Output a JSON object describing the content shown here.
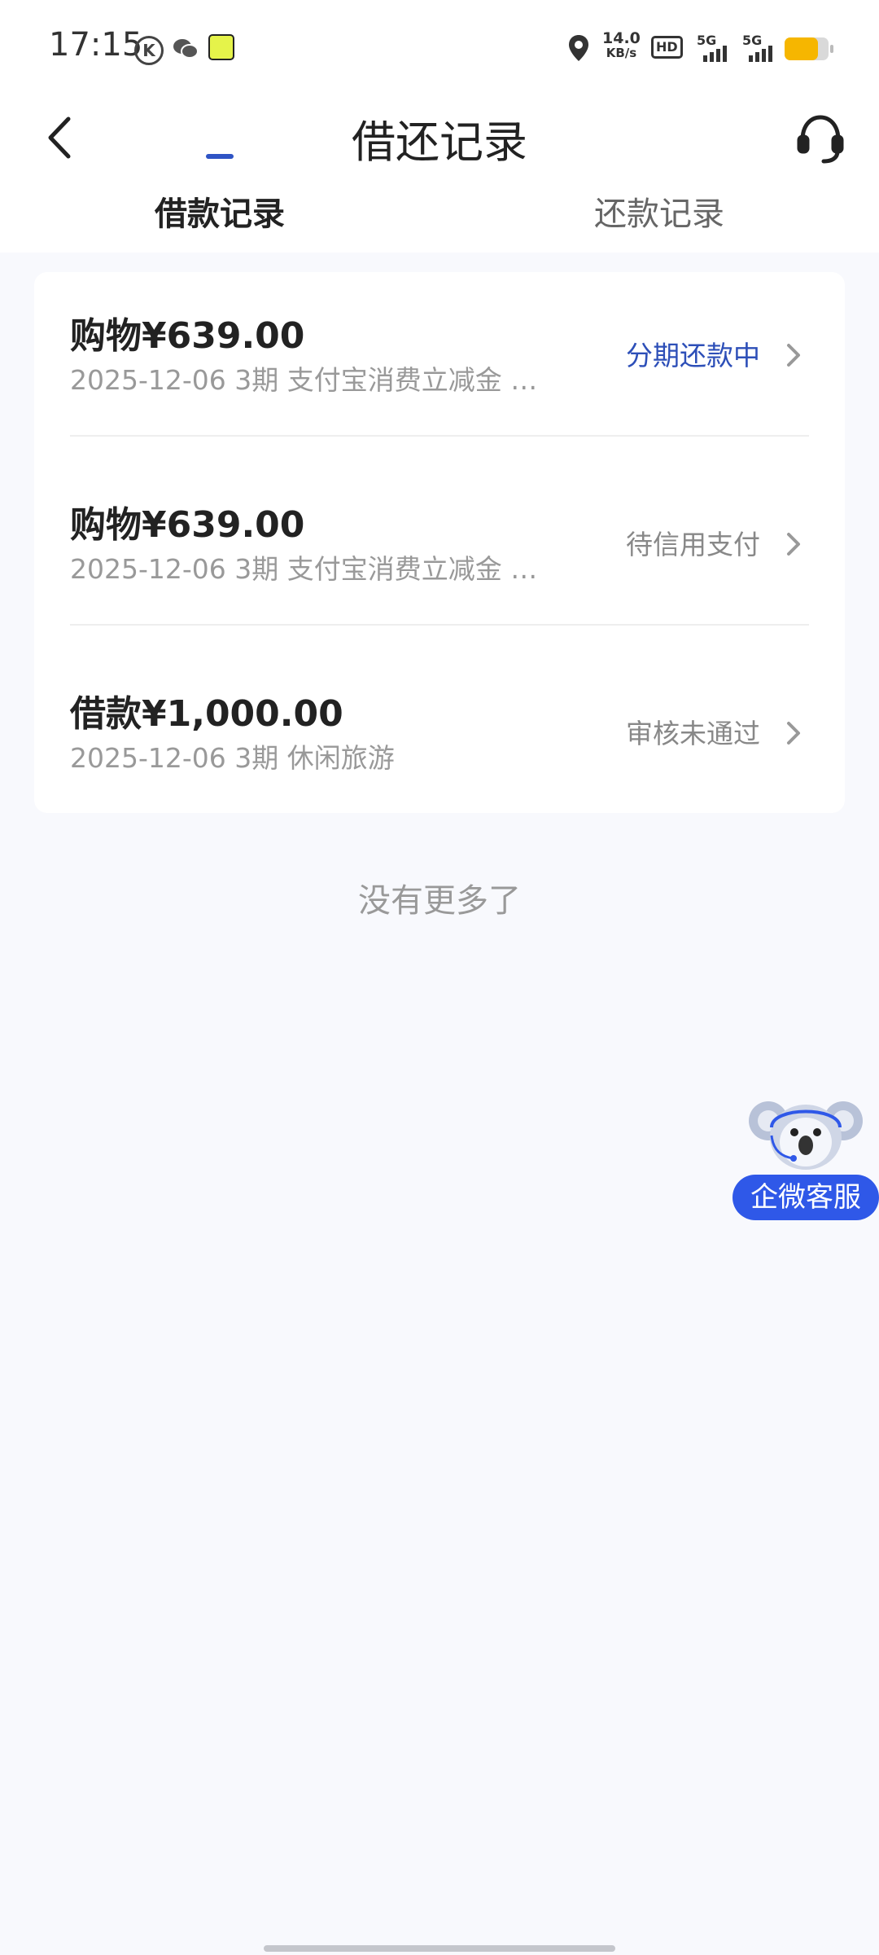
{
  "status_bar": {
    "time": "17:15",
    "network_speed_value": "14.0",
    "network_speed_unit": "KB/s",
    "hd_label": "HD",
    "sim1_label": "5G",
    "sim2_label": "5G",
    "battery_level": 0.75,
    "battery_color": "#f6b600"
  },
  "header": {
    "title": "借还记录",
    "back_icon": "chevron-left-icon",
    "support_icon": "headset-icon"
  },
  "tabs": [
    {
      "label": "借款记录",
      "active": true
    },
    {
      "label": "还款记录",
      "active": false
    }
  ],
  "records": [
    {
      "amount": "购物¥639.00",
      "meta": "2025-12-06 3期  支付宝消费立减金 …",
      "status": "分期还款中",
      "status_color": "#2d4fb8"
    },
    {
      "amount": "购物¥639.00",
      "meta": "2025-12-06 3期  支付宝消费立减金 …",
      "status": "待信用支付",
      "status_color": "#888888"
    },
    {
      "amount": "借款¥1,000.00",
      "meta": "2025-12-06 3期  休闲旅游",
      "status": "审核未通过",
      "status_color": "#888888"
    }
  ],
  "footer_note": "没有更多了",
  "float_service": {
    "label": "企微客服",
    "icon": "koala-mascot-icon",
    "color": "#2f58e8"
  }
}
